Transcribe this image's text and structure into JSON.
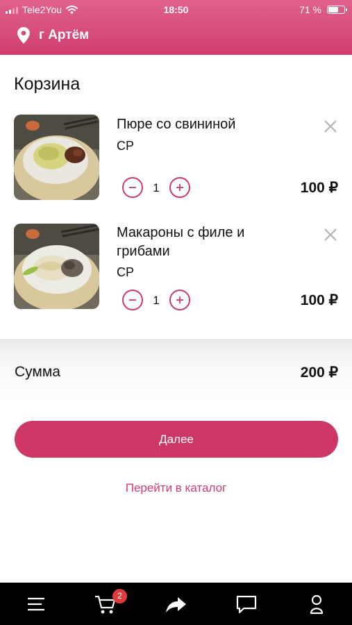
{
  "status_bar": {
    "carrier": "Tele2You",
    "time": "18:50",
    "battery_percent": "71 %",
    "battery_level": 0.71
  },
  "header": {
    "location_icon": "map-pin-icon",
    "city": "г Артём"
  },
  "cart": {
    "title": "Корзина",
    "items": [
      {
        "name": "Пюре со свининой",
        "size": "СР",
        "quantity": "1",
        "price": "100 ₽"
      },
      {
        "name": "Макароны с филе и грибами",
        "size": "СР",
        "quantity": "1",
        "price": "100 ₽"
      }
    ]
  },
  "summary": {
    "label": "Сумма",
    "total": "200 ₽"
  },
  "actions": {
    "next_label": "Далее",
    "catalog_link": "Перейти в каталог"
  },
  "tabbar": {
    "cart_badge": "2",
    "icons": [
      "menu-icon",
      "cart-icon",
      "share-icon",
      "chat-icon",
      "profile-icon"
    ]
  },
  "colors": {
    "accent": "#cc3763",
    "header_gradient_top": "#e0608c",
    "header_gradient_bottom": "#d03f6e",
    "tabbar": "#000000",
    "badge": "#e03b3b"
  }
}
